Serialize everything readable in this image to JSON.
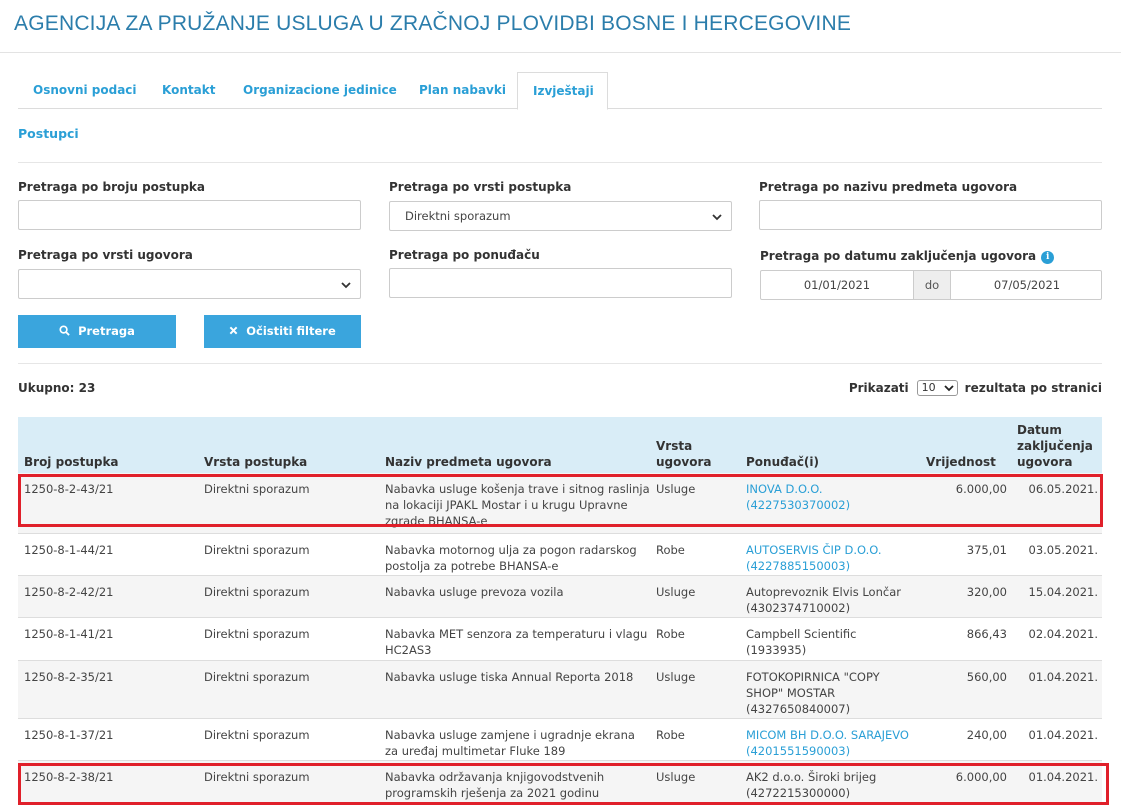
{
  "header": {
    "title": "AGENCIJA ZA PRUŽANJE USLUGA U ZRAČNOJ PLOVIDBI BOSNE I HERCEGOVINE"
  },
  "tabs": [
    {
      "label": "Osnovni podaci"
    },
    {
      "label": "Kontakt"
    },
    {
      "label": "Organizacione jedinice"
    },
    {
      "label": "Plan nabavki"
    },
    {
      "label": "Izvještaji"
    }
  ],
  "section_title": "Postupci",
  "filters": {
    "broj_label": "Pretraga po broju postupka",
    "broj_value": "",
    "vrsta_postupka_label": "Pretraga po vrsti postupka",
    "vrsta_postupka_value": "Direktni sporazum",
    "naziv_label": "Pretraga po nazivu predmeta ugovora",
    "naziv_value": "",
    "vrsta_ugovora_label": "Pretraga po vrsti ugovora",
    "vrsta_ugovora_value": "",
    "ponudjac_label": "Pretraga po ponuđaču",
    "ponudjac_value": "",
    "datum_label": "Pretraga po datumu zaključenja ugovora",
    "info_icon": "i",
    "date_from": "01/01/2021",
    "date_sep": "do",
    "date_to": "07/05/2021"
  },
  "buttons": {
    "search_label": "Pretraga",
    "clear_label": "Očistiti filtere",
    "search_icon": "search-icon",
    "clear_icon": "times-icon"
  },
  "summary": {
    "total_label": "Ukupno: 23",
    "show_label": "Prikazati",
    "per_page": "10",
    "per_page_suffix": "rezultata po stranici"
  },
  "table": {
    "headers": {
      "broj": "Broj postupka",
      "vrsta_postupka": "Vrsta postupka",
      "naziv": "Naziv predmeta ugovora",
      "vrsta_ugovora_1": "Vrsta",
      "vrsta_ugovora_2": "ugovora",
      "ponudjac": "Ponuđač(i)",
      "vrijednost": "Vrijednost",
      "datum_1": "Datum",
      "datum_2": "zaključenja",
      "datum_3": "ugovora"
    },
    "rows": [
      {
        "broj": "1250-8-2-43/21",
        "vrsta_postupka": "Direktni sporazum",
        "naziv_1": "Nabavka usluge košenja trave i sitnog raslinja",
        "naziv_2": "na lokaciji JPAKL Mostar i u krugu Upravne",
        "naziv_3": "zgrade BHANSA-e",
        "vrsta_ugovora": "Usluge",
        "ponudjac_1": "INOVA D.O.O.",
        "ponudjac_2": "(4227530370002)",
        "ponudjac_link": true,
        "vrijednost": "6.000,00",
        "datum": "06.05.2021."
      },
      {
        "broj": "1250-8-1-44/21",
        "vrsta_postupka": "Direktni sporazum",
        "naziv_1": "Nabavka motornog ulja za pogon radarskog",
        "naziv_2": "postolja za potrebe BHANSA-e",
        "naziv_3": "",
        "vrsta_ugovora": "Robe",
        "ponudjac_1": "AUTOSERVIS ČIP D.O.O.",
        "ponudjac_2": "(4227885150003)",
        "ponudjac_link": true,
        "vrijednost": "375,01",
        "datum": "03.05.2021."
      },
      {
        "broj": "1250-8-2-42/21",
        "vrsta_postupka": "Direktni sporazum",
        "naziv_1": "Nabavka usluge prevoza vozila",
        "naziv_2": "",
        "naziv_3": "",
        "vrsta_ugovora": "Usluge",
        "ponudjac_1": "Autoprevoznik Elvis Lončar",
        "ponudjac_2": "(4302374710002)",
        "ponudjac_link": false,
        "vrijednost": "320,00",
        "datum": "15.04.2021."
      },
      {
        "broj": "1250-8-1-41/21",
        "vrsta_postupka": "Direktni sporazum",
        "naziv_1": "Nabavka MET senzora za temperaturu i vlagu",
        "naziv_2": "HC2AS3",
        "naziv_3": "",
        "vrsta_ugovora": "Robe",
        "ponudjac_1": "Campbell Scientific",
        "ponudjac_2": "(1933935)",
        "ponudjac_link": false,
        "vrijednost": "866,43",
        "datum": "02.04.2021."
      },
      {
        "broj": "1250-8-2-35/21",
        "vrsta_postupka": "Direktni sporazum",
        "naziv_1": "Nabavka usluge tiska Annual Reporta 2018",
        "naziv_2": "",
        "naziv_3": "",
        "vrsta_ugovora": "Usluge",
        "ponudjac_1": "FOTOKOPIRNICA \"COPY",
        "ponudjac_2": "SHOP\" MOSTAR",
        "ponudjac_3": "(4327650840007)",
        "ponudjac_link": false,
        "vrijednost": "560,00",
        "datum": "01.04.2021."
      },
      {
        "broj": "1250-8-1-37/21",
        "vrsta_postupka": "Direktni sporazum",
        "naziv_1": "Nabavka usluge zamjene i ugradnje ekrana",
        "naziv_2": "za uređaj multimetar Fluke 189",
        "naziv_3": "",
        "vrsta_ugovora": "Robe",
        "ponudjac_1": "MICOM BH D.O.O. SARAJEVO",
        "ponudjac_2": "(4201551590003)",
        "ponudjac_link": true,
        "vrijednost": "240,00",
        "datum": "01.04.2021."
      },
      {
        "broj": "1250-8-2-38/21",
        "vrsta_postupka": "Direktni sporazum",
        "naziv_1": "Nabavka održavanja knjigovodstvenih",
        "naziv_2": "programskih rješenja za 2021 godinu",
        "naziv_3": "",
        "vrsta_ugovora": "Usluge",
        "ponudjac_1": "AK2 d.o.o. Široki brijeg",
        "ponudjac_2": "(4272215300000)",
        "ponudjac_link": false,
        "vrijednost": "6.000,00",
        "datum": "01.04.2021."
      }
    ]
  },
  "colors": {
    "accent": "#2a9fd6",
    "button": "#3aa5dd",
    "header_bg": "#d9edf7",
    "highlight": "#e0202a",
    "title": "#2b7dab"
  }
}
